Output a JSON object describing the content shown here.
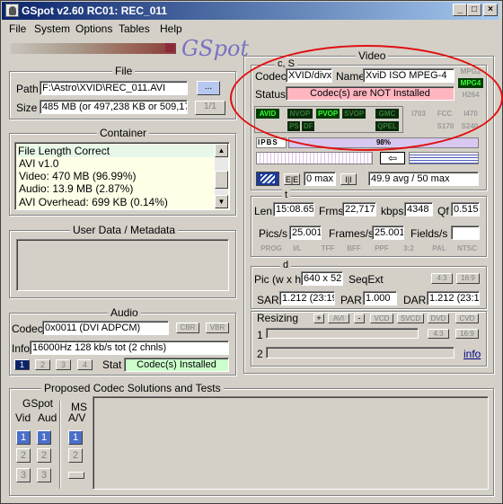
{
  "window": {
    "title": "GSpot v2.60 RC01: REC_011",
    "min_glyph": "_",
    "max_glyph": "□",
    "close_glyph": "×"
  },
  "menu": [
    "File",
    "System",
    "Options",
    "Tables",
    "Help"
  ],
  "logo_text": "GSpot",
  "file": {
    "title": "File",
    "path_label": "Path",
    "path_value": "F:\\Astro\\XVID\\REC_011.AVI",
    "browse_label": "...",
    "size_label": "Size",
    "size_value": "485 MB (or 497,238 KB or 509,17",
    "page_label": "1/1"
  },
  "container": {
    "title": "Container",
    "items": [
      "File Length Correct",
      "AVI v1.0",
      "Video: 470 MB (96.99%)",
      "Audio: 13.9 MB (2.87%)",
      "AVI Overhead: 699 KB (0.14%)"
    ]
  },
  "user_data": {
    "title": "User Data / Metadata"
  },
  "audio": {
    "title": "Audio",
    "codec_label": "Codec",
    "codec_value": "0x0011 (DVI ADPCM)",
    "cbr": "CBR",
    "vbr": "VBR",
    "info_label": "Info",
    "info_value": "16000Hz  128 kb/s tot (2 chnls)",
    "stream_buttons": [
      "1",
      "2",
      "3",
      "4"
    ],
    "stat_label": "Stat",
    "stat_value": "Codec(s) Installed"
  },
  "proposed": {
    "title": "Proposed Codec Solutions and Tests",
    "gspot_label": "GSpot",
    "vid_label": "Vid",
    "aud_label": "Aud",
    "ms_label": "MS",
    "av_label": "A/V",
    "buttons": [
      "1",
      "2",
      "3"
    ]
  },
  "video": {
    "title": "Video",
    "cs_label": "c, S",
    "codec_label": "Codec",
    "codec_value": "XVID/divx",
    "name_label": "Name",
    "name_value": "XviD ISO MPEG-4",
    "status_label": "Status",
    "status_value": "Codec(s) are NOT Installed",
    "side_flags": [
      "MPG2",
      "MPG4",
      "H264"
    ],
    "flags_row1": [
      "AVID",
      "NVOP",
      "PVOP",
      "SVOP",
      "GMC",
      "I703",
      "FCC",
      "I470"
    ],
    "flags_row2": [
      "PS",
      "DF",
      "QPEL",
      "S170",
      "S240"
    ],
    "frame_types": [
      "I",
      "P",
      "B",
      "S"
    ],
    "pct": "98%",
    "bitrate_zero": "0 max",
    "bitrate_avg": "49.9 avg / 50 max",
    "t_label": "t",
    "len_label": "Len",
    "len_value": "15:08.65",
    "frms_label": "Frms",
    "frms_value": "22,717",
    "kbps_label": "kbps",
    "kbps_value": "4348",
    "qf_label": "Qf",
    "qf_value": "0.515",
    "pics_label": "Pics/s",
    "pics_value": "25.001",
    "frames_label": "Frames/s",
    "frames_value": "25.001",
    "fields_label": "Fields/s",
    "fields_value": "",
    "flags_row3": [
      "PROG",
      "I/L",
      "TFF",
      "BFF",
      "PPF",
      "3:2",
      "PAL",
      "NTSC"
    ],
    "d_label": "d",
    "pic_label": "Pic (w x h)",
    "pic_value": "640 x 52",
    "seqext_label": "SeqExt",
    "ar43": "4:3",
    "ar169": "16:9",
    "sar_label": "SAR",
    "sar_value": "1.212 (23:19",
    "par_label": "PAR",
    "par_value": "1.000",
    "dar_label": "DAR",
    "dar_value": "1.212 (23:1",
    "resizing_label": "Resizing",
    "resize_buttons": [
      "+",
      "AVI",
      "-",
      "VCD",
      "SVCD",
      "DVD",
      "CVD"
    ],
    "r1_label": "1",
    "r2_label": "2",
    "r_ar43": "4:3",
    "r_ar169": "16:9",
    "info_link": "info"
  }
}
